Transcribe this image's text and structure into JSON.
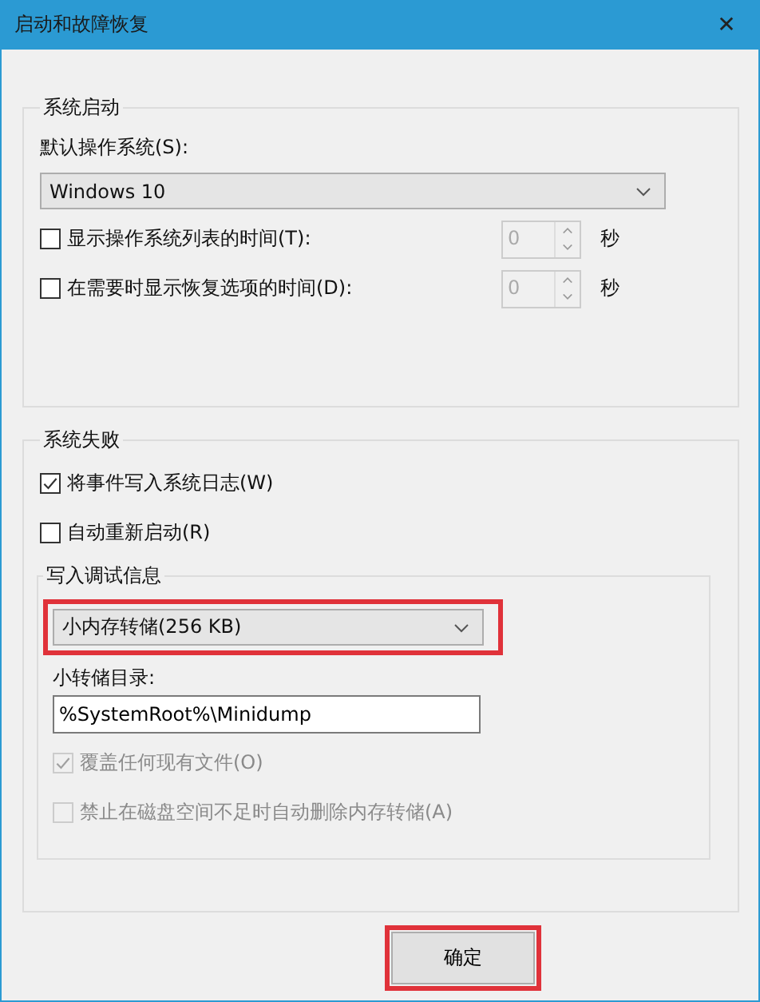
{
  "window": {
    "title": "启动和故障恢复",
    "close": "✕"
  },
  "startup": {
    "title": "系统启动",
    "os_label": "默认操作系统(S):",
    "os_value": "Windows 10",
    "options": [
      {
        "label": "显示操作系统列表的时间(T):",
        "checked": false,
        "value": "0",
        "unit": "秒"
      },
      {
        "label": "在需要时显示恢复选项的时间(D):",
        "checked": false,
        "value": "0",
        "unit": "秒"
      }
    ]
  },
  "failure": {
    "title": "系统失败",
    "options": [
      {
        "label": "将事件写入系统日志(W)",
        "checked": true
      },
      {
        "label": "自动重新启动(R)",
        "checked": false
      }
    ],
    "debug": {
      "title": "写入调试信息",
      "dump_type": "小内存转储(256 KB)",
      "highlighted": true,
      "dir_label": "小转储目录:",
      "dir_value": "%SystemRoot%\\Minidump",
      "options": [
        {
          "label": "覆盖任何现有文件(O)",
          "checked": true,
          "disabled": true
        },
        {
          "label": "禁止在磁盘空间不足时自动删除内存转储(A)",
          "checked": false,
          "disabled": true
        }
      ]
    }
  },
  "buttons": [
    {
      "label": "确定",
      "highlighted": true
    }
  ]
}
